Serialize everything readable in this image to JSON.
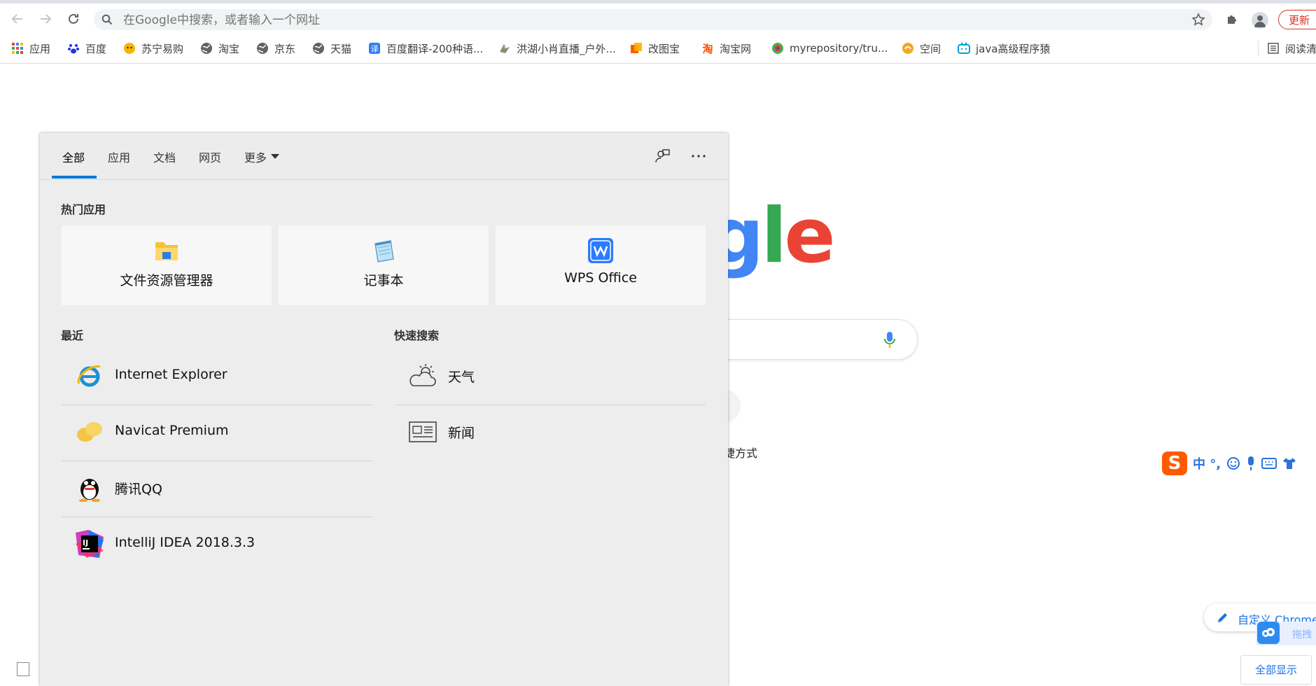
{
  "browser": {
    "address_placeholder": "在Google中搜索，或者输入一个网址",
    "update_label": "更新"
  },
  "bookmarks": [
    {
      "label": "应用",
      "icon": "apps-grid-icon"
    },
    {
      "label": "百度",
      "icon": "baidu-paw-icon"
    },
    {
      "label": "苏宁易购",
      "icon": "suning-icon"
    },
    {
      "label": "淘宝",
      "icon": "globe-icon"
    },
    {
      "label": "京东",
      "icon": "globe-icon"
    },
    {
      "label": "天猫",
      "icon": "globe-icon"
    },
    {
      "label": "百度翻译-200种语...",
      "icon": "baidu-translate-icon"
    },
    {
      "label": "洪湖小肖直播_户外...",
      "icon": "bird-icon"
    },
    {
      "label": "改图宝",
      "icon": "gaitubao-icon"
    },
    {
      "label": "淘宝网",
      "icon": "taobao-icon"
    },
    {
      "label": "myrepository/tru...",
      "icon": "repo-icon"
    },
    {
      "label": "空间",
      "icon": "qzone-icon"
    },
    {
      "label": "java高级程序猿",
      "icon": "bilibili-icon"
    },
    {
      "label": "阅读清",
      "icon": "reading-list-icon"
    }
  ],
  "google": {
    "logo_letters": [
      "g",
      "l",
      "e"
    ],
    "shortcut_partial_text": "捷方式",
    "customize_label": "自定义 Chrome",
    "show_all_label": "全部显示",
    "ime_label": "中 °,",
    "cloud_widget_label": "拖拽"
  },
  "panel": {
    "tabs": [
      {
        "label": "全部",
        "active": true
      },
      {
        "label": "应用",
        "active": false
      },
      {
        "label": "文档",
        "active": false
      },
      {
        "label": "网页",
        "active": false
      },
      {
        "label": "更多",
        "active": false
      }
    ],
    "top_apps_title": "热门应用",
    "top_apps": [
      {
        "label": "文件资源管理器",
        "icon": "file-explorer-icon"
      },
      {
        "label": "记事本",
        "icon": "notepad-icon"
      },
      {
        "label": "WPS Office",
        "icon": "wps-office-icon"
      }
    ],
    "recent_title": "最近",
    "recent": [
      {
        "label": "Internet Explorer",
        "icon": "internet-explorer-icon"
      },
      {
        "label": "Navicat Premium",
        "icon": "navicat-icon"
      },
      {
        "label": "腾讯QQ",
        "icon": "qq-penguin-icon"
      },
      {
        "label": "IntelliJ IDEA 2018.3.3",
        "icon": "intellij-idea-icon"
      }
    ],
    "quick_search_title": "快速搜索",
    "quick_search": [
      {
        "label": "天气",
        "icon": "weather-icon"
      },
      {
        "label": "新闻",
        "icon": "news-icon"
      }
    ]
  },
  "colors": {
    "accent": "#0078d7",
    "google_blue": "#4285f4",
    "google_green": "#34a853",
    "google_red": "#ea4335",
    "update_red": "#d93025"
  }
}
